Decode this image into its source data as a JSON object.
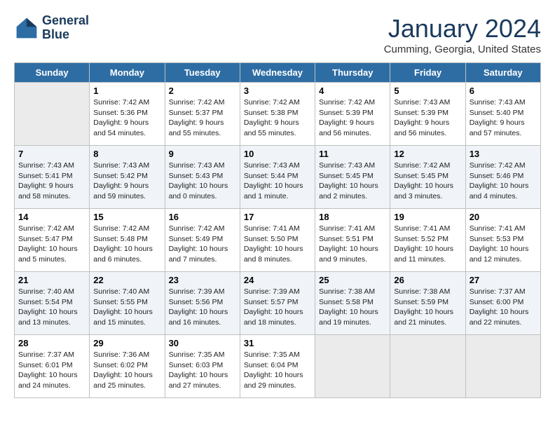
{
  "header": {
    "logo_line1": "General",
    "logo_line2": "Blue",
    "title": "January 2024",
    "subtitle": "Cumming, Georgia, United States"
  },
  "days_of_week": [
    "Sunday",
    "Monday",
    "Tuesday",
    "Wednesday",
    "Thursday",
    "Friday",
    "Saturday"
  ],
  "weeks": [
    [
      {
        "date": "",
        "sunrise": "",
        "sunset": "",
        "daylight": "",
        "empty": true
      },
      {
        "date": "1",
        "sunrise": "Sunrise: 7:42 AM",
        "sunset": "Sunset: 5:36 PM",
        "daylight": "Daylight: 9 hours and 54 minutes."
      },
      {
        "date": "2",
        "sunrise": "Sunrise: 7:42 AM",
        "sunset": "Sunset: 5:37 PM",
        "daylight": "Daylight: 9 hours and 55 minutes."
      },
      {
        "date": "3",
        "sunrise": "Sunrise: 7:42 AM",
        "sunset": "Sunset: 5:38 PM",
        "daylight": "Daylight: 9 hours and 55 minutes."
      },
      {
        "date": "4",
        "sunrise": "Sunrise: 7:42 AM",
        "sunset": "Sunset: 5:39 PM",
        "daylight": "Daylight: 9 hours and 56 minutes."
      },
      {
        "date": "5",
        "sunrise": "Sunrise: 7:43 AM",
        "sunset": "Sunset: 5:39 PM",
        "daylight": "Daylight: 9 hours and 56 minutes."
      },
      {
        "date": "6",
        "sunrise": "Sunrise: 7:43 AM",
        "sunset": "Sunset: 5:40 PM",
        "daylight": "Daylight: 9 hours and 57 minutes."
      }
    ],
    [
      {
        "date": "7",
        "sunrise": "Sunrise: 7:43 AM",
        "sunset": "Sunset: 5:41 PM",
        "daylight": "Daylight: 9 hours and 58 minutes."
      },
      {
        "date": "8",
        "sunrise": "Sunrise: 7:43 AM",
        "sunset": "Sunset: 5:42 PM",
        "daylight": "Daylight: 9 hours and 59 minutes."
      },
      {
        "date": "9",
        "sunrise": "Sunrise: 7:43 AM",
        "sunset": "Sunset: 5:43 PM",
        "daylight": "Daylight: 10 hours and 0 minutes."
      },
      {
        "date": "10",
        "sunrise": "Sunrise: 7:43 AM",
        "sunset": "Sunset: 5:44 PM",
        "daylight": "Daylight: 10 hours and 1 minute."
      },
      {
        "date": "11",
        "sunrise": "Sunrise: 7:43 AM",
        "sunset": "Sunset: 5:45 PM",
        "daylight": "Daylight: 10 hours and 2 minutes."
      },
      {
        "date": "12",
        "sunrise": "Sunrise: 7:42 AM",
        "sunset": "Sunset: 5:45 PM",
        "daylight": "Daylight: 10 hours and 3 minutes."
      },
      {
        "date": "13",
        "sunrise": "Sunrise: 7:42 AM",
        "sunset": "Sunset: 5:46 PM",
        "daylight": "Daylight: 10 hours and 4 minutes."
      }
    ],
    [
      {
        "date": "14",
        "sunrise": "Sunrise: 7:42 AM",
        "sunset": "Sunset: 5:47 PM",
        "daylight": "Daylight: 10 hours and 5 minutes."
      },
      {
        "date": "15",
        "sunrise": "Sunrise: 7:42 AM",
        "sunset": "Sunset: 5:48 PM",
        "daylight": "Daylight: 10 hours and 6 minutes."
      },
      {
        "date": "16",
        "sunrise": "Sunrise: 7:42 AM",
        "sunset": "Sunset: 5:49 PM",
        "daylight": "Daylight: 10 hours and 7 minutes."
      },
      {
        "date": "17",
        "sunrise": "Sunrise: 7:41 AM",
        "sunset": "Sunset: 5:50 PM",
        "daylight": "Daylight: 10 hours and 8 minutes."
      },
      {
        "date": "18",
        "sunrise": "Sunrise: 7:41 AM",
        "sunset": "Sunset: 5:51 PM",
        "daylight": "Daylight: 10 hours and 9 minutes."
      },
      {
        "date": "19",
        "sunrise": "Sunrise: 7:41 AM",
        "sunset": "Sunset: 5:52 PM",
        "daylight": "Daylight: 10 hours and 11 minutes."
      },
      {
        "date": "20",
        "sunrise": "Sunrise: 7:41 AM",
        "sunset": "Sunset: 5:53 PM",
        "daylight": "Daylight: 10 hours and 12 minutes."
      }
    ],
    [
      {
        "date": "21",
        "sunrise": "Sunrise: 7:40 AM",
        "sunset": "Sunset: 5:54 PM",
        "daylight": "Daylight: 10 hours and 13 minutes."
      },
      {
        "date": "22",
        "sunrise": "Sunrise: 7:40 AM",
        "sunset": "Sunset: 5:55 PM",
        "daylight": "Daylight: 10 hours and 15 minutes."
      },
      {
        "date": "23",
        "sunrise": "Sunrise: 7:39 AM",
        "sunset": "Sunset: 5:56 PM",
        "daylight": "Daylight: 10 hours and 16 minutes."
      },
      {
        "date": "24",
        "sunrise": "Sunrise: 7:39 AM",
        "sunset": "Sunset: 5:57 PM",
        "daylight": "Daylight: 10 hours and 18 minutes."
      },
      {
        "date": "25",
        "sunrise": "Sunrise: 7:38 AM",
        "sunset": "Sunset: 5:58 PM",
        "daylight": "Daylight: 10 hours and 19 minutes."
      },
      {
        "date": "26",
        "sunrise": "Sunrise: 7:38 AM",
        "sunset": "Sunset: 5:59 PM",
        "daylight": "Daylight: 10 hours and 21 minutes."
      },
      {
        "date": "27",
        "sunrise": "Sunrise: 7:37 AM",
        "sunset": "Sunset: 6:00 PM",
        "daylight": "Daylight: 10 hours and 22 minutes."
      }
    ],
    [
      {
        "date": "28",
        "sunrise": "Sunrise: 7:37 AM",
        "sunset": "Sunset: 6:01 PM",
        "daylight": "Daylight: 10 hours and 24 minutes."
      },
      {
        "date": "29",
        "sunrise": "Sunrise: 7:36 AM",
        "sunset": "Sunset: 6:02 PM",
        "daylight": "Daylight: 10 hours and 25 minutes."
      },
      {
        "date": "30",
        "sunrise": "Sunrise: 7:35 AM",
        "sunset": "Sunset: 6:03 PM",
        "daylight": "Daylight: 10 hours and 27 minutes."
      },
      {
        "date": "31",
        "sunrise": "Sunrise: 7:35 AM",
        "sunset": "Sunset: 6:04 PM",
        "daylight": "Daylight: 10 hours and 29 minutes."
      },
      {
        "date": "",
        "sunrise": "",
        "sunset": "",
        "daylight": "",
        "empty": true
      },
      {
        "date": "",
        "sunrise": "",
        "sunset": "",
        "daylight": "",
        "empty": true
      },
      {
        "date": "",
        "sunrise": "",
        "sunset": "",
        "daylight": "",
        "empty": true
      }
    ]
  ]
}
